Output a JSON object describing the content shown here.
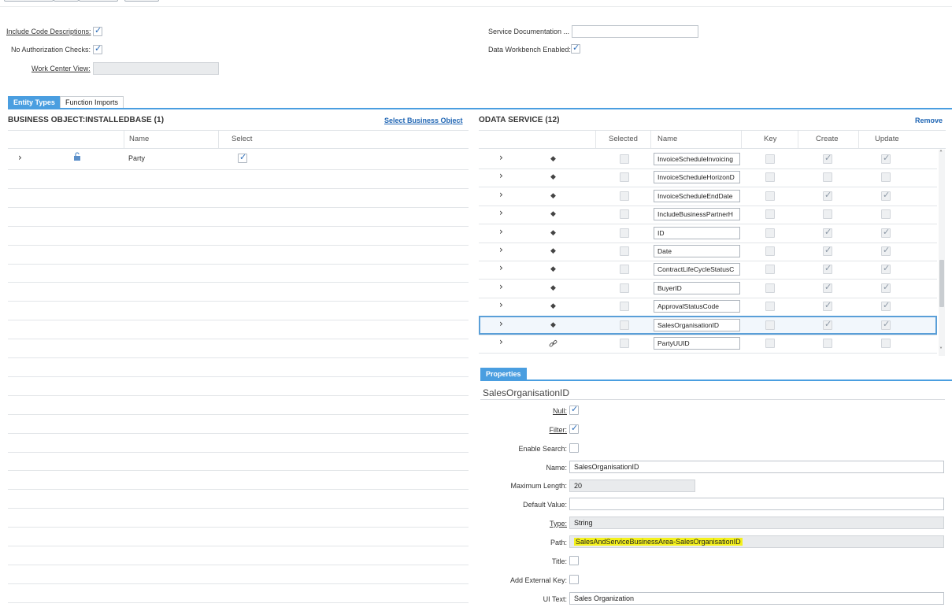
{
  "settings": {
    "include_code_descriptions_label": "Include Code Descriptions:",
    "include_code_descriptions": true,
    "no_authorization_checks_label": "No Authorization Checks:",
    "no_authorization_checks": true,
    "work_center_view_label": "Work Center View:",
    "work_center_view_value": "",
    "service_documentation_label": "Service Documentation ...",
    "service_documentation_value": "",
    "data_workbench_enabled_label": "Data Workbench Enabled:",
    "data_workbench_enabled": true
  },
  "tabs": [
    {
      "label": "Entity Types",
      "active": true
    },
    {
      "label": "Function Imports",
      "active": false
    }
  ],
  "business_object": {
    "title": "BUSINESS OBJECT:INSTALLEDBASE (1)",
    "select_link": "Select Business Object",
    "columns": [
      "Name",
      "Select"
    ],
    "rows": [
      {
        "name": "Party",
        "selected": true
      }
    ]
  },
  "odata_service": {
    "title": "ODATA SERVICE (12)",
    "remove_link": "Remove",
    "columns": [
      "Selected",
      "Name",
      "Key",
      "Create",
      "Update"
    ],
    "rows": [
      {
        "icon": "diamond-icon",
        "name": "InvoiceScheduleInvoicing",
        "selected": false,
        "key": false,
        "create": true,
        "update": true
      },
      {
        "icon": "diamond-icon",
        "name": "InvoiceScheduleHorizonD",
        "selected": false,
        "key": false,
        "create": false,
        "update": false
      },
      {
        "icon": "diamond-icon",
        "name": "InvoiceScheduleEndDate",
        "selected": false,
        "key": false,
        "create": true,
        "update": true
      },
      {
        "icon": "diamond-icon",
        "name": "IncludeBusinessPartnerH",
        "selected": false,
        "key": false,
        "create": false,
        "update": false
      },
      {
        "icon": "diamond-icon",
        "name": "ID",
        "selected": false,
        "key": false,
        "create": true,
        "update": true
      },
      {
        "icon": "diamond-icon",
        "name": "Date",
        "selected": false,
        "key": false,
        "create": true,
        "update": true
      },
      {
        "icon": "diamond-icon",
        "name": "ContractLifeCycleStatusC",
        "selected": false,
        "key": false,
        "create": true,
        "update": true
      },
      {
        "icon": "diamond-icon",
        "name": "BuyerID",
        "selected": false,
        "key": false,
        "create": true,
        "update": true
      },
      {
        "icon": "diamond-icon",
        "name": "ApprovalStatusCode",
        "selected": false,
        "key": false,
        "create": true,
        "update": true
      },
      {
        "icon": "diamond-icon",
        "name": "SalesOrganisationID",
        "selected": false,
        "key": false,
        "create": true,
        "update": true,
        "highlighted": true
      },
      {
        "icon": "link-icon",
        "name": "PartyUUID",
        "selected": false,
        "key": false,
        "create": false,
        "update": false
      }
    ]
  },
  "properties": {
    "tab_label": "Properties",
    "title": "SalesOrganisationID",
    "null_label": "Null:",
    "null": true,
    "filter_label": "Filter:",
    "filter": true,
    "enable_search_label": "Enable Search:",
    "enable_search": false,
    "name_label": "Name:",
    "name_value": "SalesOrganisationID",
    "max_length_label": "Maximum Length:",
    "max_length_value": "20",
    "default_value_label": "Default Value:",
    "default_value": "",
    "type_label": "Type:",
    "type_value": "String",
    "path_label": "Path:",
    "path_value": "SalesAndServiceBusinessArea-SalesOrganisationID",
    "title_label": "Title:",
    "title_checked": false,
    "add_external_key_label": "Add External Key:",
    "add_external_key": false,
    "ui_text_label": "UI Text:",
    "ui_text_value": "Sales Organization"
  },
  "colors": {
    "accent": "#4a9ee0",
    "link": "#2066b4",
    "highlight": "#f4f11a"
  }
}
